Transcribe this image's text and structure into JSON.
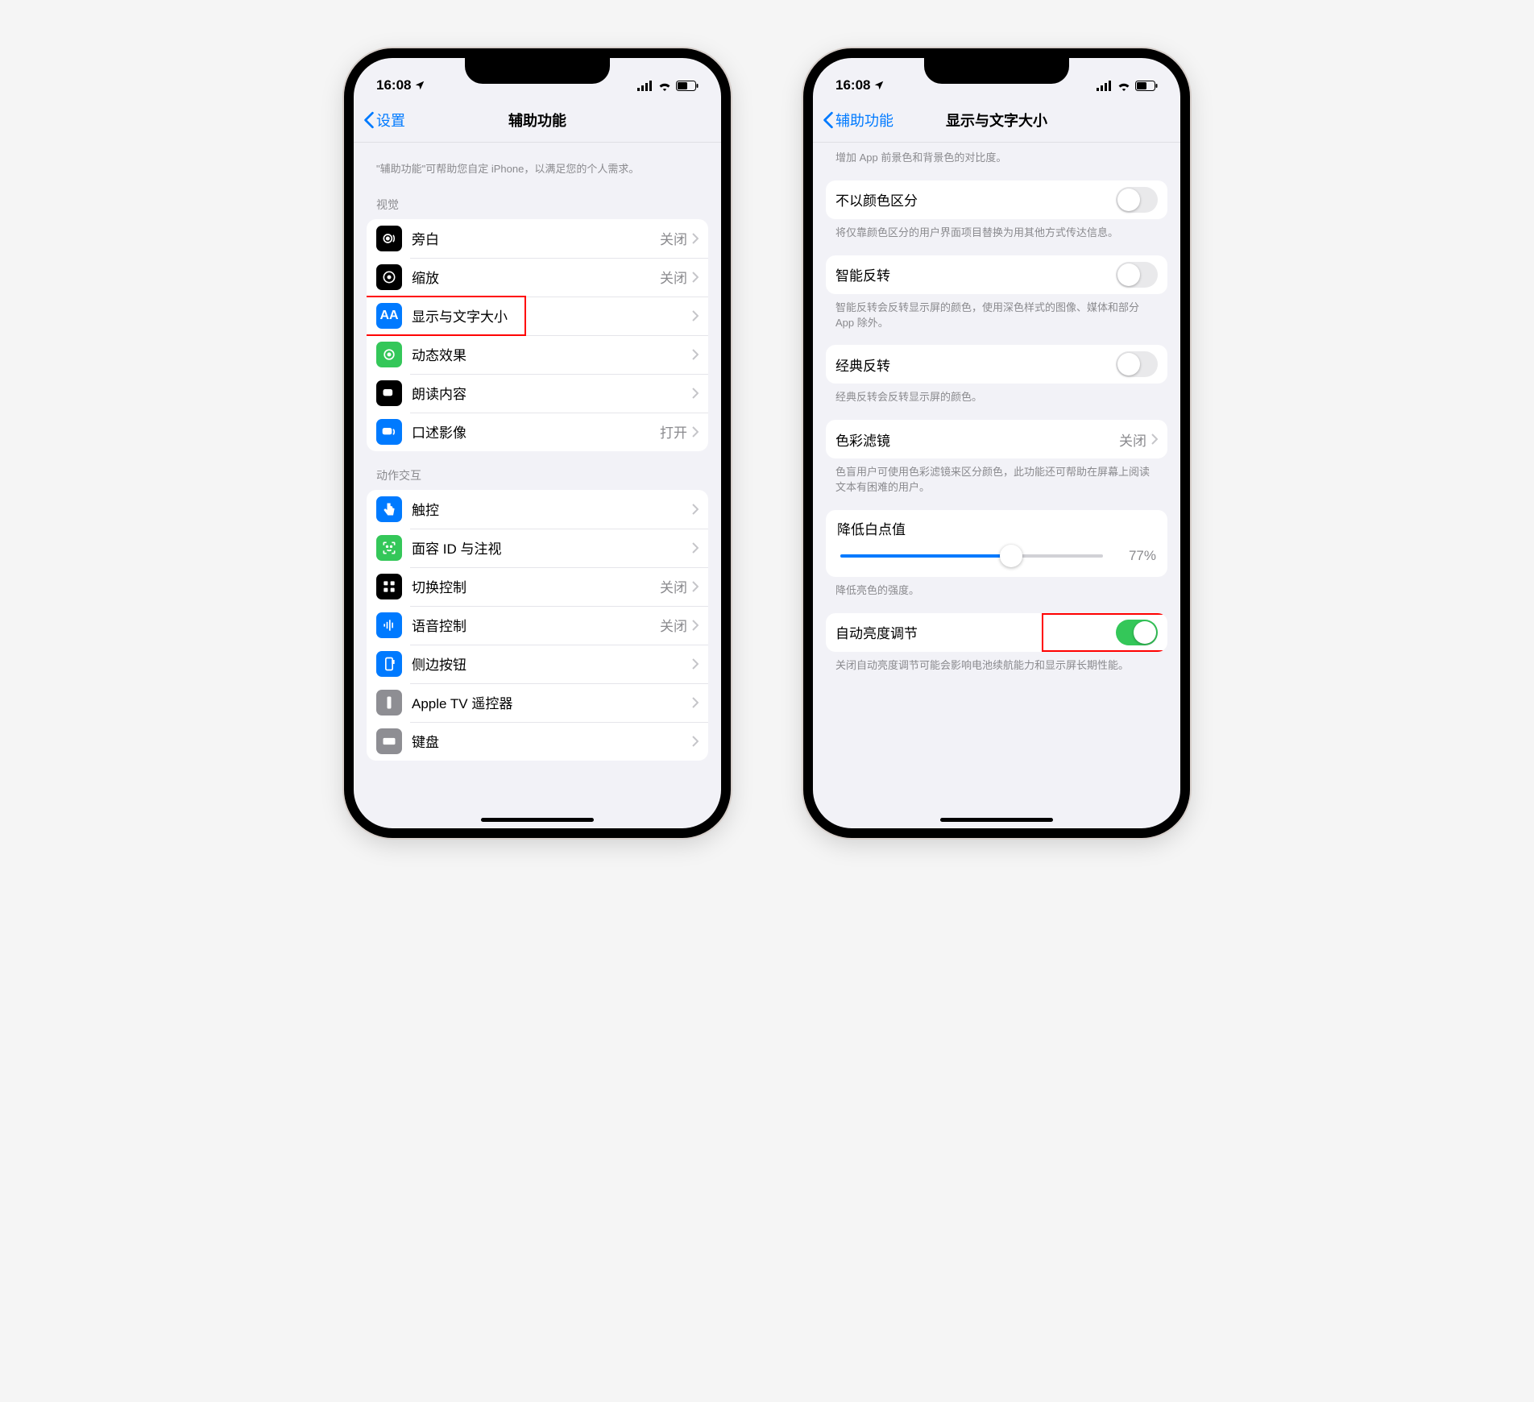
{
  "status": {
    "time": "16:08"
  },
  "phoneA": {
    "back": "设置",
    "title": "辅助功能",
    "intro": "\"辅助功能\"可帮助您自定 iPhone，以满足您的个人需求。",
    "section1_header": "视觉",
    "items1": [
      {
        "label": "旁白",
        "value": "关闭"
      },
      {
        "label": "缩放",
        "value": "关闭"
      },
      {
        "label": "显示与文字大小",
        "value": ""
      },
      {
        "label": "动态效果",
        "value": ""
      },
      {
        "label": "朗读内容",
        "value": ""
      },
      {
        "label": "口述影像",
        "value": "打开"
      }
    ],
    "section2_header": "动作交互",
    "items2": [
      {
        "label": "触控",
        "value": ""
      },
      {
        "label": "面容 ID 与注视",
        "value": ""
      },
      {
        "label": "切换控制",
        "value": "关闭"
      },
      {
        "label": "语音控制",
        "value": "关闭"
      },
      {
        "label": "侧边按钮",
        "value": ""
      },
      {
        "label": "Apple TV 遥控器",
        "value": ""
      },
      {
        "label": "键盘",
        "value": ""
      }
    ]
  },
  "phoneB": {
    "back": "辅助功能",
    "title": "显示与文字大小",
    "footer0": "增加 App 前景色和背景色的对比度。",
    "row1": {
      "label": "不以颜色区分"
    },
    "footer1": "将仅靠颜色区分的用户界面项目替换为用其他方式传达信息。",
    "row2": {
      "label": "智能反转"
    },
    "footer2": "智能反转会反转显示屏的颜色，使用深色样式的图像、媒体和部分 App 除外。",
    "row3": {
      "label": "经典反转"
    },
    "footer3": "经典反转会反转显示屏的颜色。",
    "row4": {
      "label": "色彩滤镜",
      "value": "关闭"
    },
    "footer4": "色盲用户可使用色彩滤镜来区分颜色，此功能还可帮助在屏幕上阅读文本有困难的用户。",
    "row5": {
      "label": "降低白点值",
      "pct": "77%",
      "pct_num": 77
    },
    "footer5": "降低亮色的强度。",
    "row6": {
      "label": "自动亮度调节"
    },
    "footer6": "关闭自动亮度调节可能会影响电池续航能力和显示屏长期性能。"
  }
}
